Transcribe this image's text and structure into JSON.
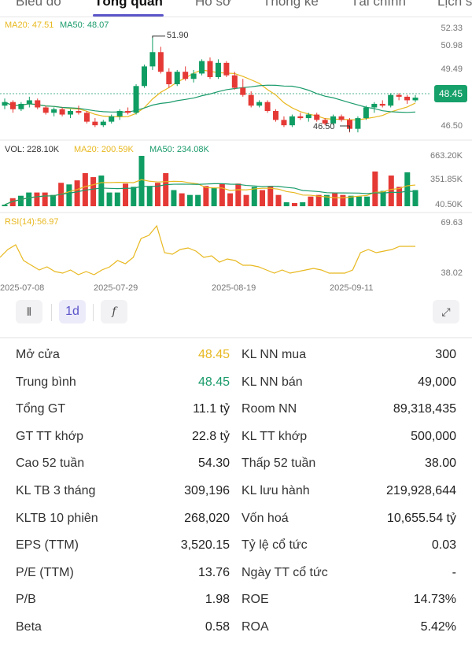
{
  "tabs": [
    "Biểu đồ",
    "Tổng quan",
    "Hồ sơ",
    "Thống kê",
    "Tài chính",
    "Lịch sử"
  ],
  "active_tab": "Tổng quan",
  "colors": {
    "up": "#0f9d63",
    "down": "#e53935",
    "ma20": "#e8b81f",
    "ma50": "#1a9b6b",
    "accent": "#5b55c9"
  },
  "chart_data": {
    "type": "candlestick",
    "price": {
      "ma20_label": "MA20: 47.51",
      "ma50_label": "MA50: 48.07",
      "axis": [
        "52.33",
        "50.98",
        "49.49",
        "46.50"
      ],
      "last_price": "48.45",
      "high_label": "51.90",
      "low_label": "46.50",
      "ylim": [
        46.2,
        52.6
      ],
      "ohlc": [
        [
          48.0,
          48.4,
          47.8,
          48.2
        ],
        [
          48.2,
          48.3,
          47.6,
          47.8
        ],
        [
          47.8,
          48.2,
          47.7,
          48.1
        ],
        [
          48.1,
          48.5,
          47.9,
          48.3
        ],
        [
          48.3,
          48.4,
          47.8,
          47.9
        ],
        [
          47.9,
          48.0,
          47.5,
          47.6
        ],
        [
          47.6,
          47.9,
          47.4,
          47.8
        ],
        [
          47.8,
          47.9,
          47.4,
          47.5
        ],
        [
          47.5,
          47.8,
          47.3,
          47.7
        ],
        [
          47.7,
          48.0,
          47.5,
          47.6
        ],
        [
          47.6,
          47.7,
          47.0,
          47.1
        ],
        [
          47.1,
          47.3,
          46.8,
          46.9
        ],
        [
          46.9,
          47.2,
          46.8,
          47.1
        ],
        [
          47.1,
          47.5,
          47.0,
          47.4
        ],
        [
          47.4,
          47.8,
          47.2,
          47.7
        ],
        [
          47.7,
          47.9,
          47.5,
          47.6
        ],
        [
          47.6,
          49.2,
          47.5,
          49.1
        ],
        [
          49.1,
          50.3,
          49.0,
          50.2
        ],
        [
          50.2,
          51.9,
          50.0,
          51.0
        ],
        [
          51.0,
          51.3,
          49.8,
          49.9
        ],
        [
          49.9,
          50.1,
          49.0,
          49.2
        ],
        [
          49.2,
          50.0,
          49.1,
          49.9
        ],
        [
          49.9,
          50.2,
          49.4,
          49.5
        ],
        [
          49.5,
          50.0,
          49.3,
          49.8
        ],
        [
          49.8,
          50.6,
          49.7,
          50.5
        ],
        [
          50.5,
          50.7,
          49.5,
          49.6
        ],
        [
          49.6,
          50.6,
          49.5,
          50.4
        ],
        [
          50.4,
          50.5,
          49.6,
          49.7
        ],
        [
          49.7,
          49.9,
          48.9,
          49.0
        ],
        [
          49.0,
          49.5,
          48.5,
          48.6
        ],
        [
          48.6,
          48.8,
          47.9,
          48.0
        ],
        [
          48.0,
          48.3,
          47.9,
          48.2
        ],
        [
          48.2,
          48.3,
          47.6,
          47.7
        ],
        [
          47.7,
          47.8,
          47.1,
          47.2
        ],
        [
          47.2,
          47.4,
          46.8,
          46.9
        ],
        [
          46.9,
          47.5,
          46.8,
          47.4
        ],
        [
          47.4,
          47.6,
          47.2,
          47.3
        ],
        [
          47.3,
          47.6,
          47.1,
          47.5
        ],
        [
          47.5,
          47.6,
          47.1,
          47.2
        ],
        [
          47.2,
          47.3,
          46.9,
          47.0
        ],
        [
          47.0,
          47.5,
          46.9,
          47.4
        ],
        [
          47.4,
          47.5,
          47.1,
          47.2
        ],
        [
          47.2,
          47.3,
          46.5,
          46.7
        ],
        [
          46.7,
          47.4,
          46.5,
          47.3
        ],
        [
          47.3,
          48.0,
          47.2,
          47.9
        ],
        [
          47.9,
          48.2,
          47.6,
          48.1
        ],
        [
          48.1,
          48.3,
          47.9,
          48.0
        ],
        [
          48.0,
          48.7,
          47.9,
          48.6
        ],
        [
          48.6,
          48.7,
          48.3,
          48.5
        ],
        [
          48.5,
          48.6,
          48.1,
          48.3
        ],
        [
          48.3,
          48.6,
          48.2,
          48.45
        ]
      ]
    },
    "volume": {
      "label": "VOL: 228.10K",
      "ma20_label": "MA20: 200.59K",
      "ma50_label": "MA50: 234.08K",
      "axis": [
        "663.20K",
        "351.85K",
        "40.50K"
      ],
      "ylim": [
        40.5,
        663.2
      ],
      "values": [
        60,
        140,
        170,
        210,
        210,
        210,
        180,
        330,
        310,
        360,
        450,
        400,
        420,
        210,
        210,
        320,
        280,
        663,
        290,
        330,
        450,
        240,
        200,
        180,
        180,
        290,
        270,
        320,
        200,
        320,
        180,
        280,
        240,
        290,
        180,
        90,
        80,
        90,
        160,
        180,
        180,
        200,
        180,
        170,
        160,
        160,
        470,
        230,
        420,
        280,
        460,
        240
      ]
    },
    "rsi": {
      "label": "RSI(14):56.97",
      "axis": [
        "69.63",
        "38.02"
      ],
      "ylim": [
        36,
        71
      ],
      "values": [
        50,
        55,
        58,
        48,
        45,
        42,
        44,
        41,
        40,
        42,
        39,
        41,
        39,
        42,
        44,
        48,
        46,
        50,
        62,
        64,
        70,
        53,
        52,
        55,
        56,
        54,
        50,
        51,
        47,
        49,
        48,
        45,
        45,
        44,
        42,
        40,
        42,
        40,
        41,
        42,
        43,
        42,
        40,
        40,
        40,
        42,
        53,
        55,
        53,
        54,
        55,
        57,
        57,
        57
      ]
    },
    "dates": [
      "2025-07-08",
      "2025-07-29",
      "2025-08-19",
      "2025-09-11"
    ]
  },
  "toolbar": {
    "interval": "1d"
  },
  "stats": [
    {
      "k1": "Mở cửa",
      "v1": "48.45",
      "c1": "#e8b81f",
      "k2": "KL NN mua",
      "v2": "300"
    },
    {
      "k1": "Trung bình",
      "v1": "48.45",
      "c1": "#1a9b6b",
      "k2": "KL NN bán",
      "v2": "49,000"
    },
    {
      "k1": "Tổng GT",
      "v1": "11.1 tỷ",
      "k2": "Room NN",
      "v2": "89,318,435"
    },
    {
      "k1": "GT TT khớp",
      "v1": "22.8 tỷ",
      "k2": "KL TT khớp",
      "v2": "500,000"
    },
    {
      "k1": "Cao 52 tuần",
      "v1": "54.30",
      "k2": "Thấp 52 tuần",
      "v2": "38.00"
    },
    {
      "k1": "KL TB 3 tháng",
      "v1": "309,196",
      "k2": "KL lưu hành",
      "v2": "219,928,644"
    },
    {
      "k1": "KLTB 10 phiên",
      "v1": "268,020",
      "k2": "Vốn hoá",
      "v2": "10,655.54 tỷ"
    },
    {
      "k1": "EPS (TTM)",
      "v1": "3,520.15",
      "k2": "Tỷ lệ cổ tức",
      "v2": "0.03"
    },
    {
      "k1": "P/E (TTM)",
      "v1": "13.76",
      "k2": "Ngày TT cổ tức",
      "v2": "-"
    },
    {
      "k1": "P/B",
      "v1": "1.98",
      "k2": "ROE",
      "v2": "14.73%"
    },
    {
      "k1": "Beta",
      "v1": "0.58",
      "k2": "ROA",
      "v2": "5.42%"
    }
  ]
}
